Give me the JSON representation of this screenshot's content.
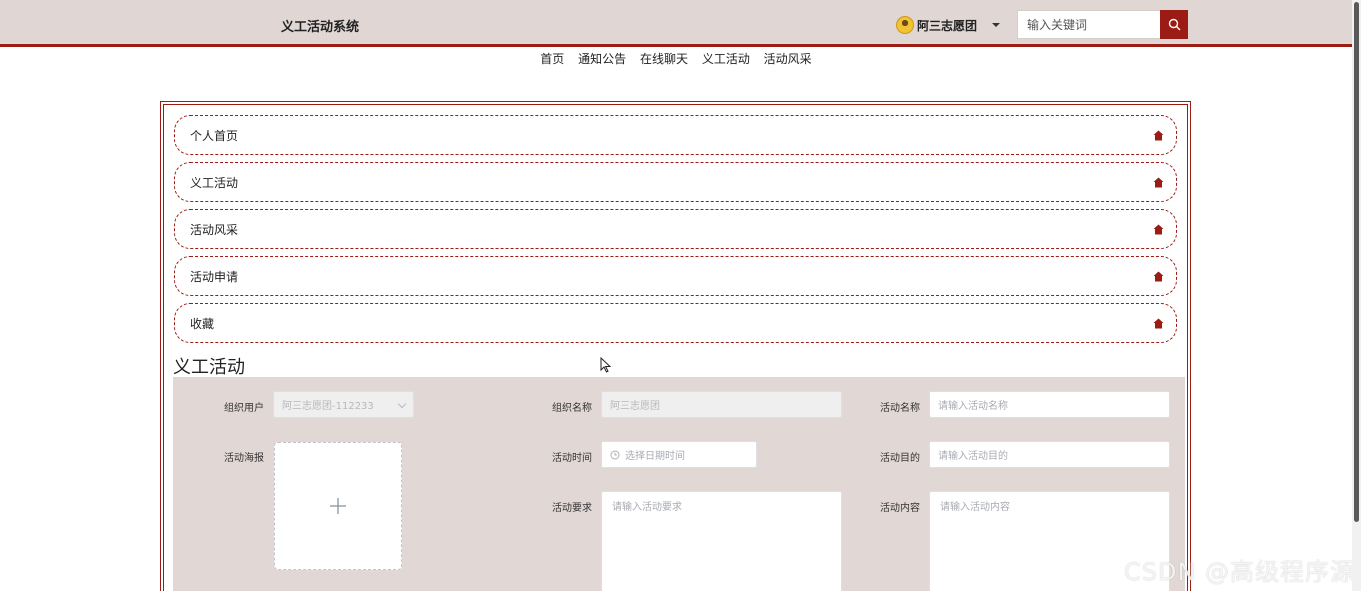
{
  "header": {
    "brand": "义工活动系统",
    "user_name": "阿三志愿团",
    "search_placeholder": "输入关键词"
  },
  "nav": [
    "首页",
    "通知公告",
    "在线聊天",
    "义工活动",
    "活动风采"
  ],
  "menu": [
    "个人首页",
    "义工活动",
    "活动风采",
    "活动申请",
    "收藏"
  ],
  "section_title": "义工活动",
  "form": {
    "org_user_label": "组织用户",
    "org_user_value": "阿三志愿团-112233",
    "org_name_label": "组织名称",
    "org_name_value": "阿三志愿团",
    "activity_name_label": "活动名称",
    "activity_name_placeholder": "请输入活动名称",
    "poster_label": "活动海报",
    "time_label": "活动时间",
    "time_placeholder": "选择日期时间",
    "purpose_label": "活动目的",
    "purpose_placeholder": "请输入活动目的",
    "requirement_label": "活动要求",
    "requirement_placeholder": "请输入活动要求",
    "content_label": "活动内容",
    "content_placeholder": "请输入活动内容"
  },
  "watermark": "CSDN @高级程序源",
  "colors": {
    "accent": "#9b1c14",
    "header_bg": "#e0d6d4",
    "form_bg": "#e1d7d5"
  }
}
